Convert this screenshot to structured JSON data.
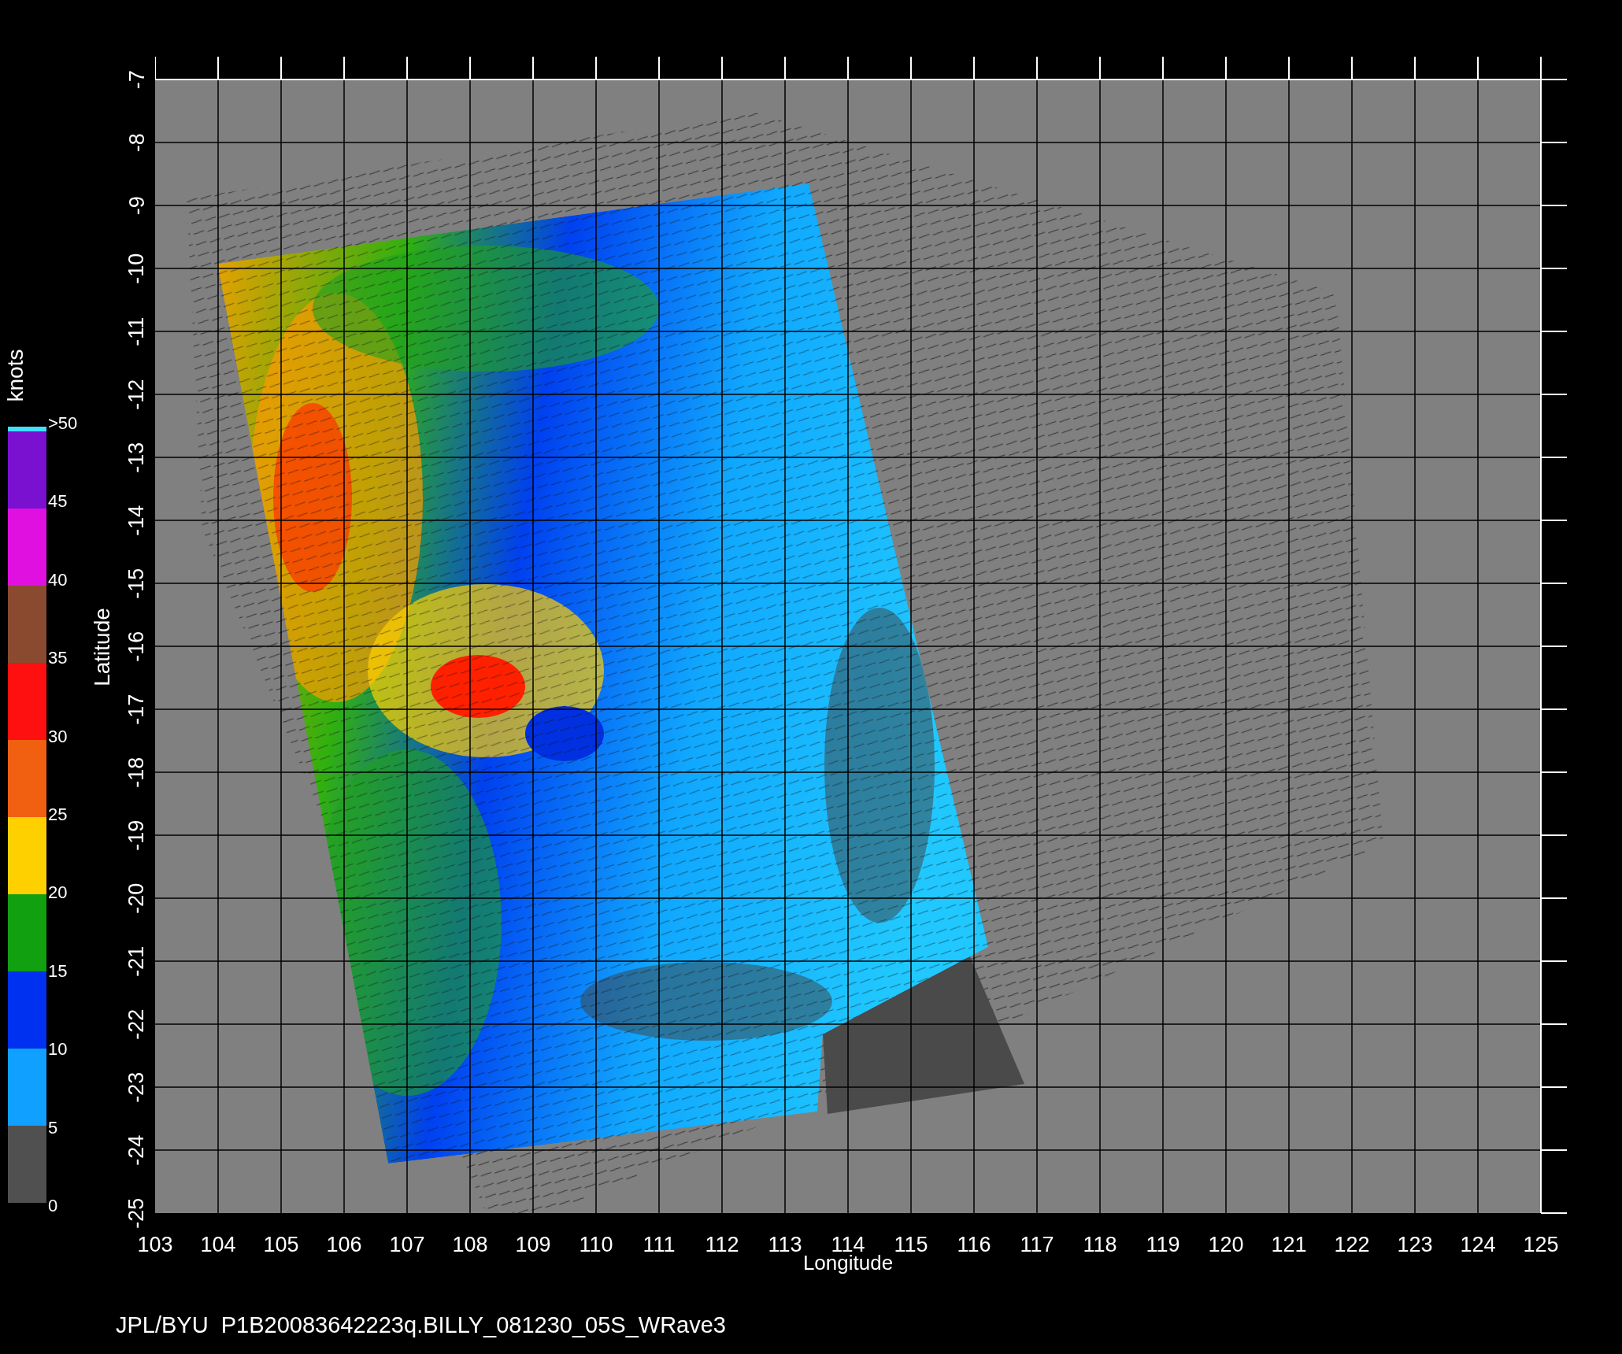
{
  "colorbar": {
    "unit": "knots",
    "labels": [
      ">50",
      "45",
      "40",
      "35",
      "30",
      "25",
      "20",
      "15",
      "10",
      "5",
      "0"
    ],
    "segments": [
      {
        "color": "#7a10d0"
      },
      {
        "color": "#e010e0"
      },
      {
        "color": "#8a4a30"
      },
      {
        "color": "#ff1010"
      },
      {
        "color": "#f06010"
      },
      {
        "color": "#ffd000"
      },
      {
        "color": "#10a010"
      },
      {
        "color": "#0030f0"
      },
      {
        "color": "#10a0ff"
      },
      {
        "color": "#505050"
      }
    ]
  },
  "y_axis": {
    "title": "Latitude",
    "ticks": [
      "-7",
      "-8",
      "-9",
      "-10",
      "-11",
      "-12",
      "-13",
      "-14",
      "-15",
      "-16",
      "-17",
      "-18",
      "-19",
      "-20",
      "-21",
      "-22",
      "-23",
      "-24",
      "-25"
    ]
  },
  "x_axis": {
    "title": "Longitude",
    "ticks": [
      "103",
      "104",
      "105",
      "106",
      "107",
      "108",
      "109",
      "110",
      "111",
      "112",
      "113",
      "114",
      "115",
      "116",
      "117",
      "118",
      "119",
      "120",
      "121",
      "122",
      "123",
      "124",
      "125"
    ]
  },
  "caption": "JPL/BYU  P1B20083642223q.BILLY_081230_05S_WRave3"
}
